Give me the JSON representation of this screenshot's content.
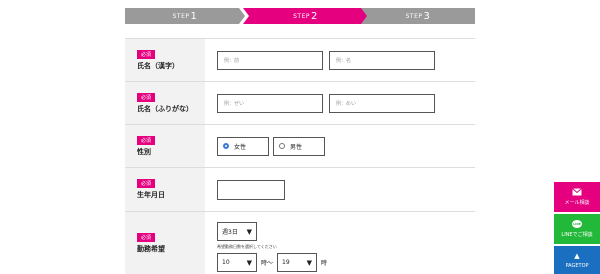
{
  "steps": [
    {
      "prefix": "STEP",
      "num": "1"
    },
    {
      "prefix": "STEP",
      "num": "2"
    },
    {
      "prefix": "STEP",
      "num": "3"
    }
  ],
  "form": {
    "name_kanji": {
      "required": "必須",
      "label": "氏名（漢字）",
      "last_placeholder": "例：前",
      "first_placeholder": "例：名"
    },
    "name_kana": {
      "required": "必須",
      "label": "氏名（ふりがな）",
      "last_placeholder": "例：ぜい",
      "first_placeholder": "例：めい"
    },
    "gender": {
      "required": "必須",
      "label": "性別",
      "options": [
        "女性",
        "男性"
      ],
      "selected": "女性"
    },
    "birthday": {
      "required": "必須",
      "label": "生年月日",
      "value": ""
    },
    "work_pref": {
      "required": "必須",
      "label": "勤務希望",
      "days_value": "週3日",
      "note": "希望勤務日数を選択してください",
      "time_from": "10",
      "time_sep": "時〜",
      "time_to": "19",
      "time_unit": "時"
    }
  },
  "float_buttons": {
    "mail": "メール相談",
    "line_icon": "LINE",
    "line": "LINEでご相談",
    "pagetop": "PAGETOP"
  },
  "colors": {
    "accent": "#e4007f",
    "line": "#22b83a",
    "pagetop": "#1a6fc0",
    "step_inactive": "#9a9a9a"
  }
}
